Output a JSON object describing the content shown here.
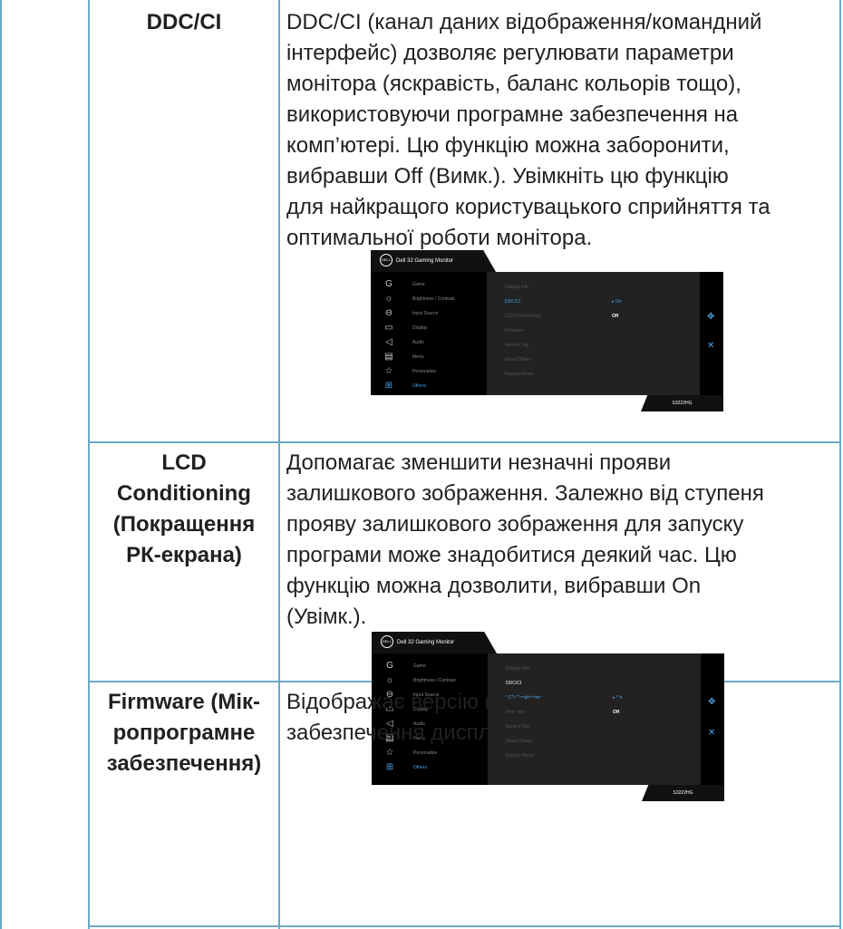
{
  "rows": [
    {
      "label": "DDC/CI",
      "description": [
        "DDC/CI (канал даних відображення/командний",
        "інтерфейс) дозволяє регулювати параметри",
        "монітора (яскравість, баланс кольорів тощо),",
        "використовуючи програмне забезпечення на",
        "комп’ютері. Цю функцію можна заборонити,",
        "вибравши Off (Вимк.). Увімкніть цю функцію",
        "для найкращого користувацького сприйняття та",
        "оптимальної роботи монітора."
      ]
    },
    {
      "label": [
        "LCD",
        "Conditioning",
        "(Покращення",
        "РК-екрана)"
      ],
      "description": [
        "Допомагає зменшити незначні прояви",
        "залишкового зображення. Залежно від ступеня",
        "прояву залишкового зображення для запуску",
        "програми може знадобитися деякий час. Цю",
        "функцію можна дозволити, вибравши On",
        "(Увімк.)."
      ]
    },
    {
      "label": [
        "Firmware (Мік-",
        "ропрограмне",
        "забезпечення)"
      ],
      "description": [
        "Відображає версію мікропрограмного",
        "забезпечення дисплея."
      ]
    }
  ],
  "osd": {
    "title": "Dell 32 Gaming Monitor",
    "logo": "DELL",
    "model": "S3222HG",
    "menu": [
      {
        "icon": "game-icon",
        "glyph": "G",
        "label": "Game"
      },
      {
        "icon": "brightness-icon",
        "glyph": "☼",
        "label": "Brightness / Contrast"
      },
      {
        "icon": "input-source-icon",
        "glyph": "⊖",
        "label": "Input Source"
      },
      {
        "icon": "display-icon",
        "glyph": "▭",
        "label": "Display"
      },
      {
        "icon": "audio-icon",
        "glyph": "◁",
        "label": "Audio"
      },
      {
        "icon": "menu-icon",
        "glyph": "▤",
        "label": "Menu"
      },
      {
        "icon": "star-icon",
        "glyph": "☆",
        "label": "Personalize"
      },
      {
        "icon": "others-icon",
        "glyph": "⊞",
        "label": "Others"
      }
    ],
    "submenu": [
      "Display Info",
      "DDC/CI",
      "LCD Conditioning",
      "Firmware",
      "Service Tag",
      "Reset Others",
      "Factory Reset"
    ],
    "opt_on": "On",
    "opt_off": "Off",
    "nav_glyph": "✥",
    "close_glyph": "✕"
  }
}
